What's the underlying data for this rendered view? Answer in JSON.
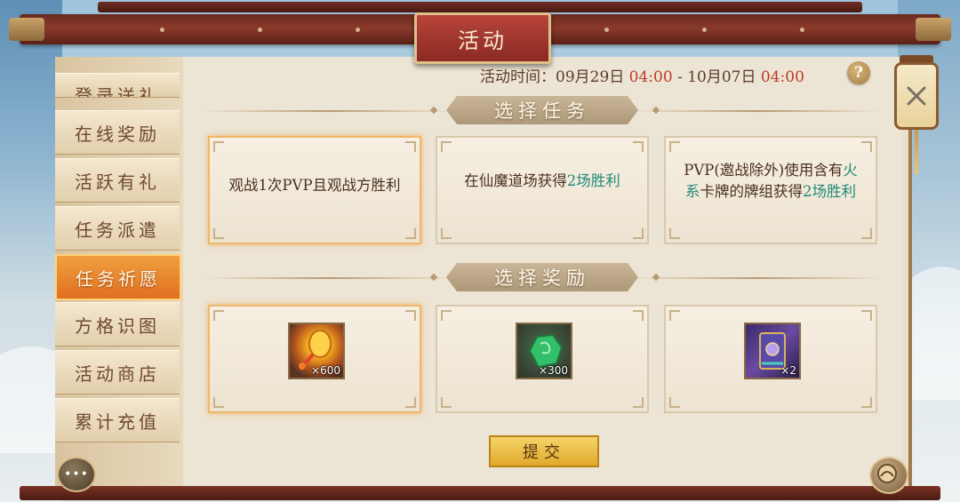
{
  "title": "活动",
  "header": {
    "time_label": "活动时间：",
    "start_date": "09月29日",
    "start_time": "04:00",
    "separator": "-",
    "end_date": "10月07日",
    "end_time": "04:00",
    "help": "?"
  },
  "sidebar": {
    "items": [
      {
        "label": "登录送礼",
        "active": false
      },
      {
        "label": "在线奖励",
        "active": false
      },
      {
        "label": "活跃有礼",
        "active": false
      },
      {
        "label": "任务派遣",
        "active": false
      },
      {
        "label": "任务祈愿",
        "active": true
      },
      {
        "label": "方格识图",
        "active": false
      },
      {
        "label": "活动商店",
        "active": false
      },
      {
        "label": "累计充值",
        "active": false
      }
    ]
  },
  "sections": {
    "tasks_title": "选择任务",
    "rewards_title": "选择奖励"
  },
  "tasks": [
    {
      "text": "观战1次PVP且观战方胜利"
    },
    {
      "pre": "在仙魔道场获得",
      "highlight": "2场胜利"
    },
    {
      "pre": "PVP(邀战除外)使用含有",
      "fire": "火系",
      "mid": "卡牌的牌组获得",
      "highlight": "2场胜利"
    }
  ],
  "rewards": [
    {
      "icon": "lantern-fan-item-icon",
      "count": "×600"
    },
    {
      "icon": "jade-stone-item-icon",
      "count": "×300"
    },
    {
      "icon": "card-pack-item-icon",
      "count": "×2"
    }
  ],
  "submit_label": "提交",
  "close_icon": "close-icon",
  "colors": {
    "accent_active": "#e07020",
    "time_highlight": "#c0392b",
    "task_highlight": "#1f8a7a"
  }
}
